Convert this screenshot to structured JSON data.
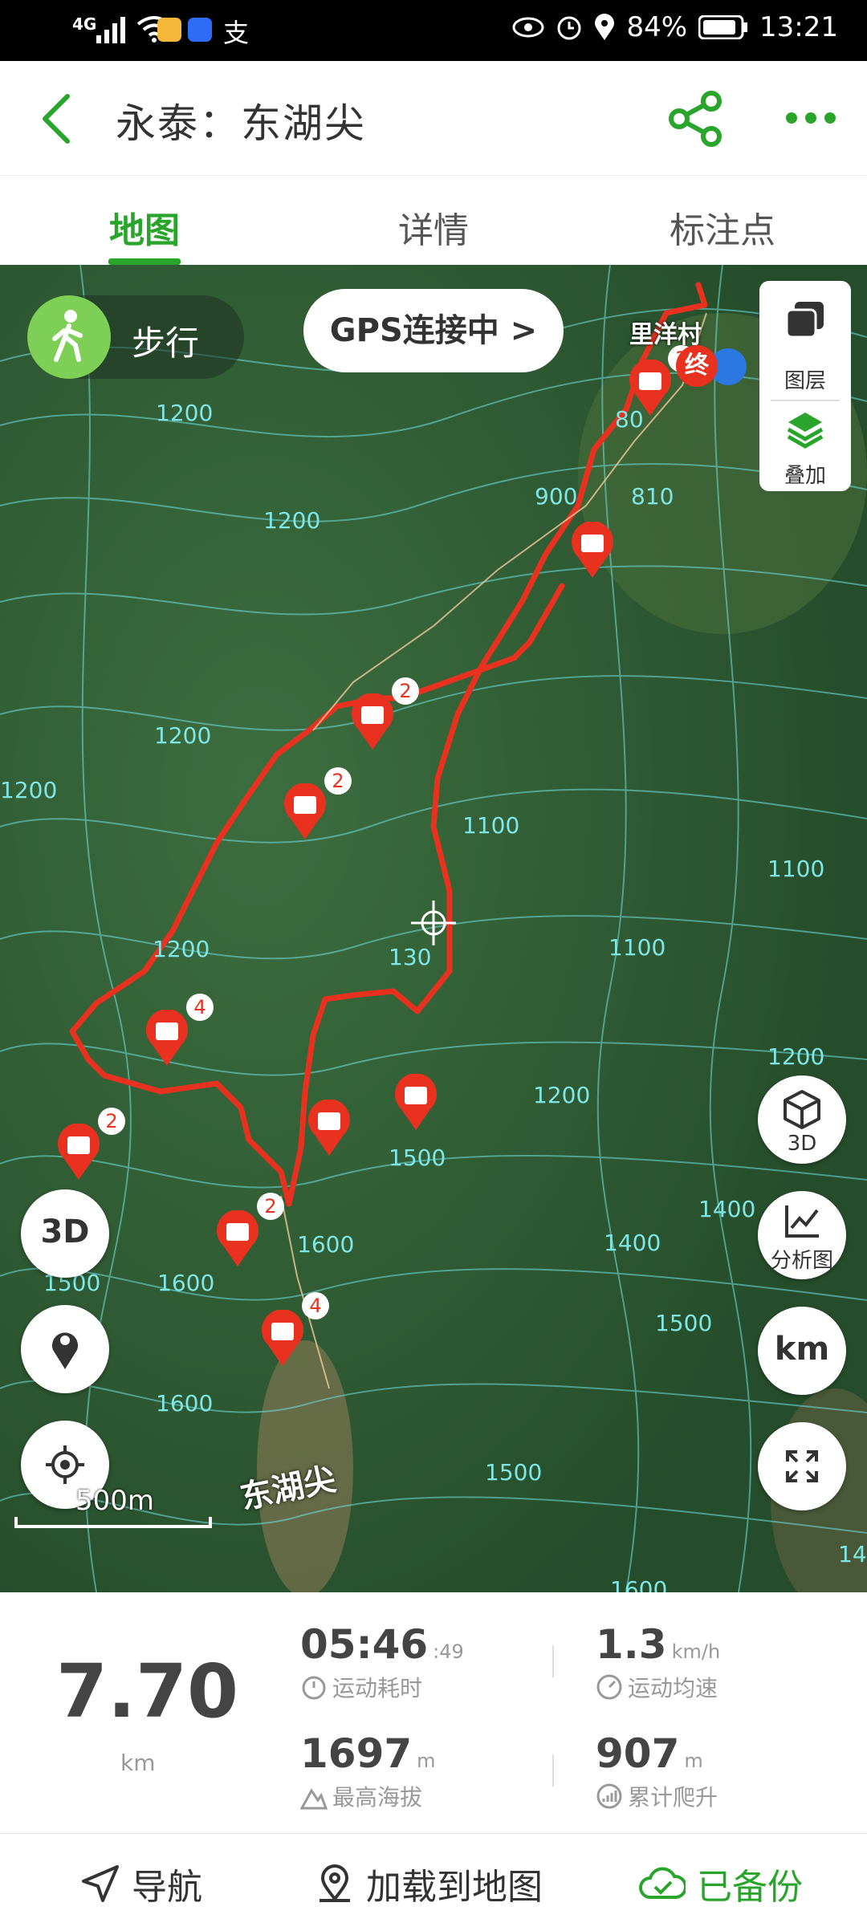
{
  "status_bar": {
    "network": "4G",
    "battery": "84%",
    "time": "13:21",
    "icons": [
      "signal-icon",
      "wifi-icon",
      "app-icon",
      "bulb-icon",
      "alipay-icon",
      "eye-icon",
      "alarm-icon",
      "location-icon",
      "battery-icon"
    ]
  },
  "header": {
    "title": "永泰：东湖尖",
    "back_icon": "back-arrow-icon",
    "share_icon": "share-icon",
    "more_icon": "more-dots-icon"
  },
  "tabs": [
    {
      "label": "地图",
      "active": true
    },
    {
      "label": "详情",
      "active": false
    },
    {
      "label": "标注点",
      "active": false
    }
  ],
  "map": {
    "mode_label": "步行",
    "gps_button": "GPS连接中 >",
    "layers": {
      "layer_label": "图层",
      "overlay_label": "叠加"
    },
    "right_buttons": [
      {
        "label": "3D",
        "icon": "cube-icon"
      },
      {
        "label": "分析图",
        "icon": "chart-icon"
      },
      {
        "label": "km",
        "icon": "km-icon"
      },
      {
        "label": "",
        "icon": "fullscreen-icon"
      }
    ],
    "left_buttons": [
      "3d-toggle-icon",
      "footprint-icon",
      "locate-icon"
    ],
    "scale_label": "500m",
    "place_labels": {
      "village": "里洋村",
      "peak": "东湖尖"
    },
    "end_marker": "终",
    "contour_labels": [
      "1200",
      "1200",
      "1200",
      "900",
      "80",
      "810",
      "1100",
      "1100",
      "1100",
      "1200",
      "1200",
      "130",
      "1200",
      "1500",
      "1500",
      "1600",
      "1600",
      "1400",
      "1600",
      "1500",
      "1500",
      "1400",
      "1200",
      "1600",
      "14"
    ],
    "marker_counts": [
      "2",
      "2",
      "2",
      "4",
      "2",
      "2",
      "4"
    ]
  },
  "stats": {
    "distance": "7.70",
    "distance_unit": "km",
    "duration": "05:46",
    "duration_seconds": ":49",
    "duration_label": "运动耗时",
    "avg_speed": "1.3",
    "avg_speed_unit": "km/h",
    "avg_speed_label": "运动均速",
    "max_altitude": "1697",
    "max_altitude_unit": "m",
    "max_altitude_label": "最高海拔",
    "total_climb": "907",
    "total_climb_unit": "m",
    "total_climb_label": "累计爬升"
  },
  "footer": {
    "navigate": "导航",
    "load_to_map": "加载到地图",
    "backed_up": "已备份"
  },
  "colors": {
    "accent": "#2aa52c",
    "track": "#e8321f",
    "map_bg": "#2f5d35",
    "contour": "#6fe0e0"
  }
}
